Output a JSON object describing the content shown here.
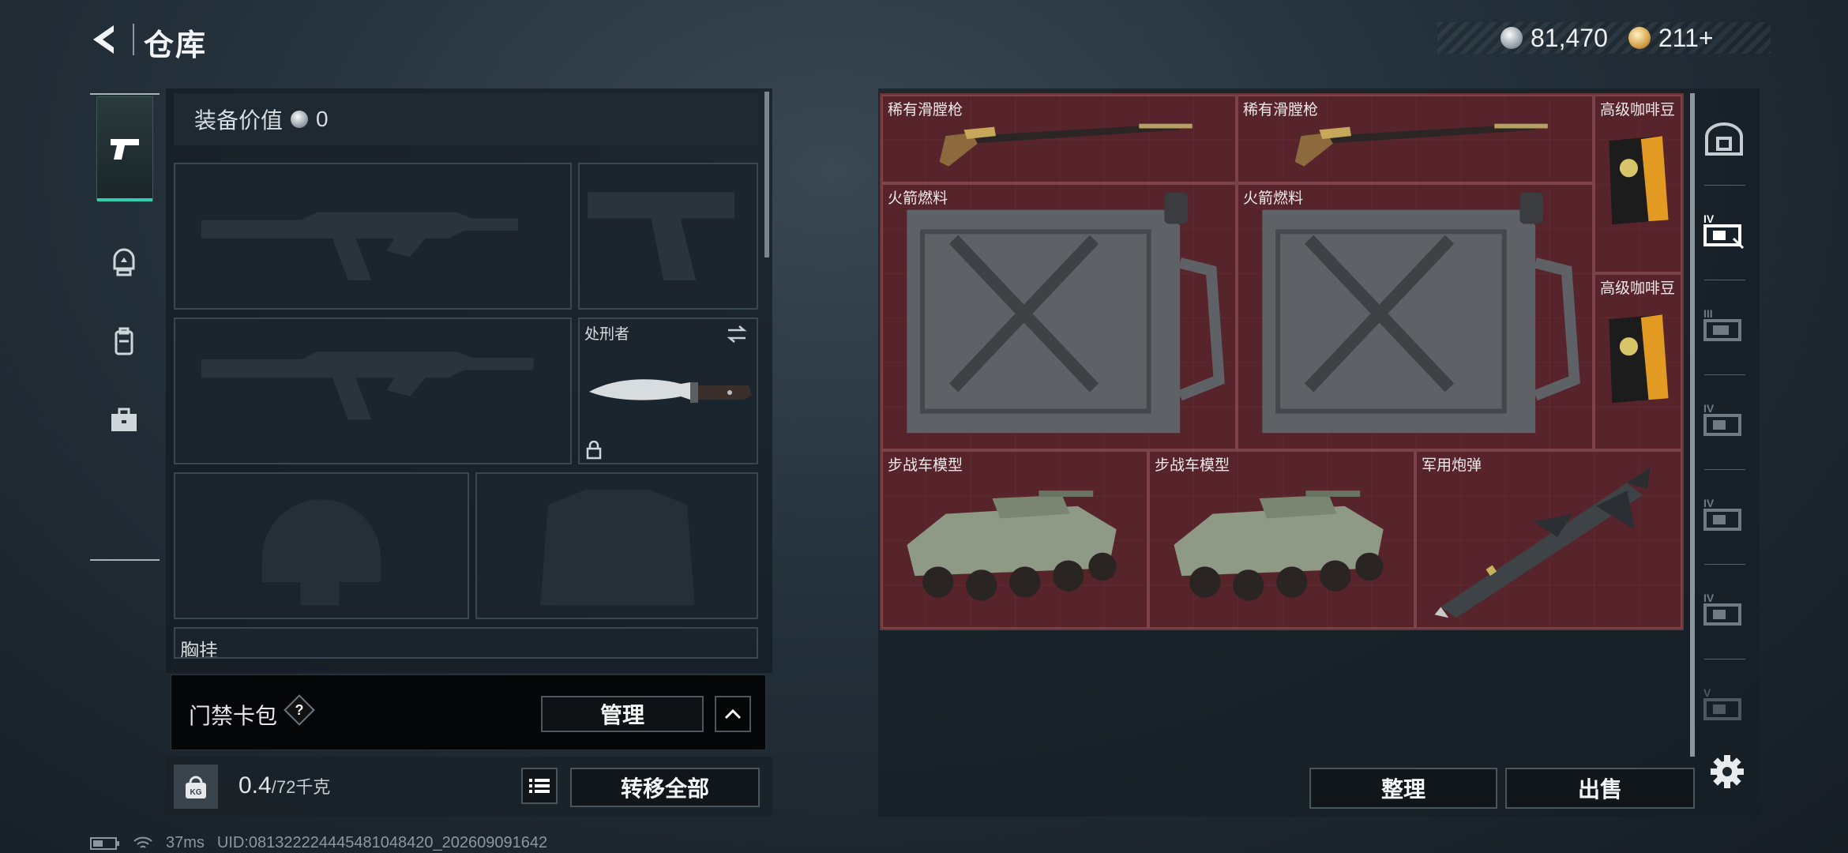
{
  "header": {
    "title": "仓库",
    "currency": [
      {
        "icon": "silver-coin-icon",
        "value": "81,470"
      },
      {
        "icon": "gold-coin-icon",
        "value": "211+"
      }
    ]
  },
  "left_nav": {
    "items": [
      {
        "icon": "pistol-icon",
        "active": true
      },
      {
        "icon": "helmet-icon",
        "active": false
      },
      {
        "icon": "backpack-icon",
        "active": false
      },
      {
        "icon": "toolbox-icon",
        "active": false
      }
    ]
  },
  "equipment": {
    "value_label": "装备价值",
    "value": "0",
    "melee_slot_label": "处刑者",
    "partial_label": "胸挂"
  },
  "access_card": {
    "label": "门禁卡包",
    "help": "?",
    "manage_label": "管理"
  },
  "weight": {
    "kg_label": "KG",
    "current": "0.4",
    "max": "/72千克",
    "transfer_all_label": "转移全部"
  },
  "stash": {
    "items": [
      {
        "label": "稀有滑膛枪",
        "art": "musket"
      },
      {
        "label": "稀有滑膛枪",
        "art": "musket"
      },
      {
        "label": "高级咖啡豆",
        "art": "coffee"
      },
      {
        "label": "火箭燃料",
        "art": "jerrycan"
      },
      {
        "label": "火箭燃料",
        "art": "jerrycan"
      },
      {
        "label": "高级咖啡豆",
        "art": "coffee"
      },
      {
        "label": "步战车模型",
        "art": "ifv"
      },
      {
        "label": "步战车模型",
        "art": "ifv"
      },
      {
        "label": "军用炮弹",
        "art": "missile"
      }
    ]
  },
  "right_tabs": {
    "items": [
      {
        "icon": "safe-box-icon",
        "active": false
      },
      {
        "icon": "case-tier-4-icon",
        "active": true,
        "tier": "IV"
      },
      {
        "icon": "case-tier-3-icon",
        "active": false,
        "tier": "III"
      },
      {
        "icon": "case-tier-4-icon",
        "active": false,
        "tier": "IV"
      },
      {
        "icon": "case-tier-4-icon",
        "active": false,
        "tier": "IV"
      },
      {
        "icon": "case-tier-4-icon",
        "active": false,
        "tier": "IV"
      },
      {
        "icon": "case-tier-5-icon",
        "active": false,
        "tier": "V"
      }
    ]
  },
  "actions": {
    "sort_label": "整理",
    "sell_label": "出售"
  },
  "status": {
    "ping": "37ms",
    "id": "UID:0813222244454810484​20_202609091642"
  },
  "colors": {
    "accent": "#2fd0b0",
    "stash_bg": "#4e1f24",
    "panel_bg": "#16202a"
  }
}
